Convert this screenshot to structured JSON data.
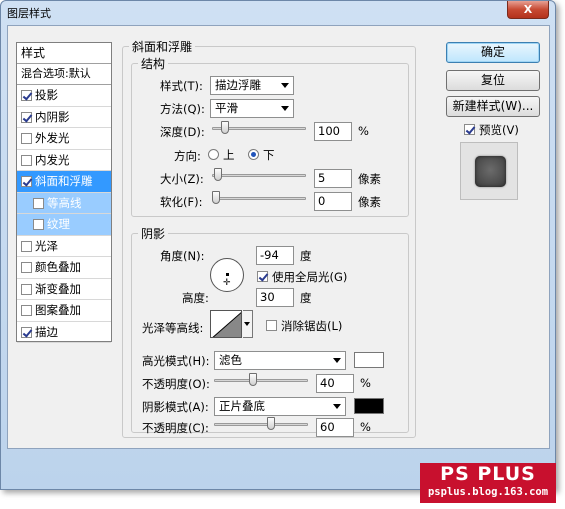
{
  "window": {
    "title": "图层样式",
    "close_label": "X"
  },
  "sidebar": {
    "header": "样式",
    "blend_options": "混合选项:默认",
    "items": [
      {
        "label": "投影",
        "checked": true,
        "state": "normal"
      },
      {
        "label": "内阴影",
        "checked": true,
        "state": "normal"
      },
      {
        "label": "外发光",
        "checked": false,
        "state": "normal"
      },
      {
        "label": "内发光",
        "checked": false,
        "state": "normal"
      },
      {
        "label": "斜面和浮雕",
        "checked": true,
        "state": "active"
      },
      {
        "label": "等高线",
        "checked": false,
        "state": "sub"
      },
      {
        "label": "纹理",
        "checked": false,
        "state": "sub"
      },
      {
        "label": "光泽",
        "checked": false,
        "state": "normal"
      },
      {
        "label": "颜色叠加",
        "checked": false,
        "state": "normal"
      },
      {
        "label": "渐变叠加",
        "checked": false,
        "state": "normal"
      },
      {
        "label": "图案叠加",
        "checked": false,
        "state": "normal"
      },
      {
        "label": "描边",
        "checked": true,
        "state": "normal"
      }
    ]
  },
  "bevel": {
    "section_title": "斜面和浮雕",
    "structure_title": "结构",
    "style_label": "样式(T):",
    "style_value": "描边浮雕",
    "technique_label": "方法(Q):",
    "technique_value": "平滑",
    "depth_label": "深度(D):",
    "depth_value": "100",
    "depth_unit": "%",
    "depth_level": 0.1,
    "direction_label": "方向:",
    "direction_up": "上",
    "direction_down": "下",
    "direction_selected": "down",
    "size_label": "大小(Z):",
    "size_value": "5",
    "size_unit": "像素",
    "size_level": 0.02,
    "soften_label": "软化(F):",
    "soften_value": "0",
    "soften_unit": "像素",
    "soften_level": 0.0
  },
  "shading": {
    "title": "阴影",
    "angle_label": "角度(N):",
    "angle_value": "-94",
    "angle_unit": "度",
    "global_light_label": "使用全局光(G)",
    "global_light_checked": true,
    "altitude_label": "高度:",
    "altitude_value": "30",
    "altitude_unit": "度",
    "gloss_contour_label": "光泽等高线:",
    "antialias_label": "消除锯齿(L)",
    "antialias_checked": false,
    "highlight_mode_label": "高光模式(H):",
    "highlight_mode_value": "滤色",
    "highlight_color": "#ffffff",
    "highlight_opacity_label": "不透明度(O):",
    "highlight_opacity_value": "40",
    "highlight_opacity_level": 0.4,
    "opacity_unit": "%",
    "shadow_mode_label": "阴影模式(A):",
    "shadow_mode_value": "正片叠底",
    "shadow_color": "#000000",
    "shadow_opacity_label": "不透明度(C):",
    "shadow_opacity_value": "60",
    "shadow_opacity_level": 0.6
  },
  "buttons": {
    "ok": "确定",
    "reset": "复位",
    "new_style": "新建样式(W)...",
    "preview_label": "预览(V)",
    "preview_checked": true
  },
  "watermark": {
    "title": "PS PLUS",
    "url": "psplus.blog.163.com"
  },
  "colors": {
    "accent": "#3399ff",
    "sub_item": "#99ccff",
    "watermark_red": "#c8102e"
  }
}
